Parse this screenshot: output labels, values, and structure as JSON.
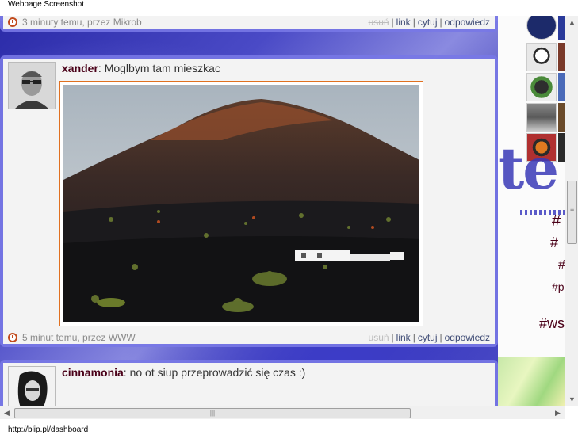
{
  "window": {
    "title": "Webpage Screenshot"
  },
  "status_bar": {
    "url": "http://blip.pl/dashboard"
  },
  "posts": [
    {
      "meta": {
        "time": "3 minuty temu, przez Mikrob"
      },
      "actions": {
        "delete": "usuń",
        "link": "link",
        "quote": "cytuj",
        "reply": "odpowiedz"
      }
    },
    {
      "author": "xander",
      "text": ": Moglbym tam mieszkac",
      "meta": {
        "time": "5 minut temu, przez WWW"
      },
      "actions": {
        "delete": "usuń",
        "link": "link",
        "quote": "cytuj",
        "reply": "odpowiedz"
      }
    },
    {
      "author": "cinnamonia",
      "text": ": no ot siup przeprowadzić się czas :)"
    }
  ],
  "sidebar": {
    "tags": [
      "#",
      "#",
      "#",
      "#p",
      "#ws"
    ]
  },
  "icons": {
    "clock": "clock-icon",
    "scroll_up": "arrow-up-icon",
    "scroll_down": "arrow-down-icon",
    "scroll_left": "arrow-left-icon",
    "scroll_right": "arrow-right-icon"
  },
  "colors": {
    "author": "#4a0018",
    "card_border": "#7878e6",
    "link": "#3d4a74",
    "clock": "#c14a1c",
    "image_frame": "#e07020"
  },
  "scrollbar": {
    "grip": "≡",
    "hgrip": "|||"
  }
}
